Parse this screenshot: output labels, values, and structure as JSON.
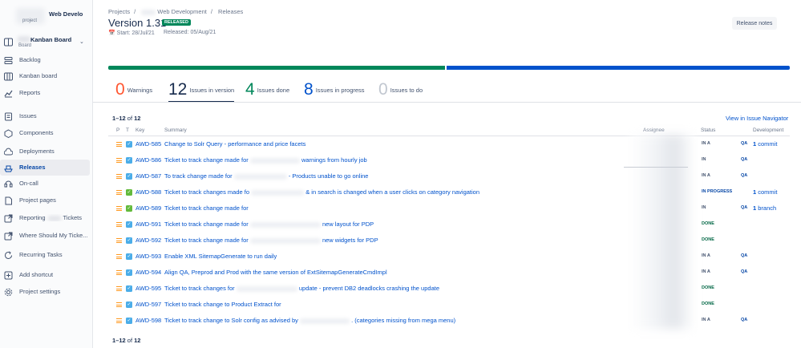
{
  "project": {
    "name": "Web Develo",
    "type": "project"
  },
  "board": {
    "name": "Kanban Board",
    "type": "Board"
  },
  "sidebar": {
    "items": [
      {
        "label": "Backlog",
        "icon": "backlog-icon",
        "name": "sidebar-item-backlog"
      },
      {
        "label": "Kanban board",
        "icon": "board-icon",
        "name": "sidebar-item-kanban-board"
      },
      {
        "label": "Reports",
        "icon": "chart-icon",
        "name": "sidebar-item-reports"
      },
      {
        "label": "Issues",
        "icon": "issues-icon",
        "name": "sidebar-item-issues"
      },
      {
        "label": "Components",
        "icon": "components-icon",
        "name": "sidebar-item-components"
      },
      {
        "label": "Deployments",
        "icon": "cloud-icon",
        "name": "sidebar-item-deployments"
      },
      {
        "label": "Releases",
        "icon": "ship-icon",
        "name": "sidebar-item-releases",
        "active": true
      },
      {
        "label": "On-call",
        "icon": "on-call-icon",
        "name": "sidebar-item-on-call"
      },
      {
        "label": "Project pages",
        "icon": "page-icon",
        "name": "sidebar-item-project-pages"
      },
      {
        "label_a": "Reporting",
        "label_b": "Tickets",
        "icon": "shortcut-icon",
        "name": "sidebar-item-reporting-tickets"
      },
      {
        "label": "Where Should My Ticke...",
        "icon": "shortcut-icon",
        "name": "sidebar-item-where-should"
      },
      {
        "label": "Recurring Tasks",
        "icon": "recurring-icon",
        "name": "sidebar-item-recurring-tasks"
      },
      {
        "label": "Add shortcut",
        "icon": "add-shortcut-icon",
        "name": "sidebar-item-add-shortcut"
      },
      {
        "label": "Project settings",
        "icon": "gear-icon",
        "name": "sidebar-item-project-settings"
      }
    ]
  },
  "breadcrumbs": {
    "projects": "Projects",
    "sep": "/",
    "project": "Web Development",
    "releases": "Releases"
  },
  "version": {
    "title": "Version 1.31",
    "badge": "RELEASED",
    "start": "Start: 28/Jul/21",
    "released": "Released: 05/Aug/21",
    "release_notes_label": "Release notes"
  },
  "progress": {
    "done_fraction": 0.495,
    "in_progress_fraction": 0.505
  },
  "stats": [
    {
      "num": "0",
      "label": "Warnings",
      "color": "#ff5630"
    },
    {
      "num": "12",
      "label": "Issues in version",
      "color": "#172b4d",
      "selected": true
    },
    {
      "num": "4",
      "label": "Issues done",
      "color": "#00875a"
    },
    {
      "num": "8",
      "label": "Issues in progress",
      "color": "#0052cc"
    },
    {
      "num": "0",
      "label": "Issues to do",
      "color": "#c1c7d0"
    }
  ],
  "count": {
    "range": "1–12",
    "of": "of",
    "total": "12"
  },
  "view_navigator": "View in Issue Navigator",
  "columns": {
    "p": "P",
    "t": "T",
    "key": "Key",
    "summary": "Summary",
    "assignee": "Assignee",
    "status": "Status",
    "development": "Development"
  },
  "issues": [
    {
      "key": "AWD-585",
      "type": "task",
      "summary_a": "Change to Solr Query - performance and price facets",
      "blur": 0,
      "summary_b": "",
      "status": "IN A",
      "status_kind": "review",
      "qa": "QA",
      "dev_num": "1",
      "dev_label": "commit"
    },
    {
      "key": "AWD-586",
      "type": "task",
      "summary_a": "Ticket to track change made for",
      "blur": 62,
      "summary_b": "warnings from hourly job",
      "status": "IN",
      "status_kind": "review",
      "qa": "QA",
      "dev_num": "",
      "dev_label": ""
    },
    {
      "key": "AWD-587",
      "type": "task",
      "summary_a": "To track change made for",
      "blur": 66,
      "summary_b": "- Products unable to go online",
      "status": "IN A",
      "status_kind": "review",
      "qa": "QA",
      "dev_num": "",
      "dev_label": ""
    },
    {
      "key": "AWD-588",
      "type": "story",
      "summary_a": "Ticket to track changes made fo",
      "blur": 66,
      "summary_b": "& in search is changed when a user clicks on category navigation",
      "status": "IN PROGRESS",
      "status_kind": "inprog",
      "qa": "",
      "dev_num": "1",
      "dev_label": "commit"
    },
    {
      "key": "AWD-589",
      "type": "story",
      "summary_a": "Ticket to track change made for",
      "blur": 0,
      "summary_b": "",
      "status": "IN",
      "status_kind": "review",
      "qa": "QA",
      "dev_num": "1",
      "dev_label": "branch"
    },
    {
      "key": "AWD-591",
      "type": "task",
      "summary_a": "Ticket to track change made for",
      "blur": 88,
      "summary_b": "new layout for PDP",
      "status": "DONE",
      "status_kind": "done",
      "qa": "",
      "dev_num": "",
      "dev_label": ""
    },
    {
      "key": "AWD-592",
      "type": "task",
      "summary_a": "Ticket to track change made for",
      "blur": 88,
      "summary_b": "new widgets for PDP",
      "status": "DONE",
      "status_kind": "done",
      "qa": "",
      "dev_num": "",
      "dev_label": ""
    },
    {
      "key": "AWD-593",
      "type": "task",
      "summary_a": "Enable XML SitemapGenerate to run daily",
      "blur": 0,
      "summary_b": "",
      "status": "IN A",
      "status_kind": "review",
      "qa": "QA",
      "dev_num": "",
      "dev_label": ""
    },
    {
      "key": "AWD-594",
      "type": "task",
      "summary_a": "Align QA, Preprod and Prod with the same version of ExtSitemapGenerateCmdImpl",
      "blur": 0,
      "summary_b": "",
      "status": "IN A",
      "status_kind": "review",
      "qa": "QA",
      "dev_num": "",
      "dev_label": ""
    },
    {
      "key": "AWD-595",
      "type": "task",
      "summary_a": "Ticket to track changes for",
      "blur": 76,
      "summary_b": "update - prevent DB2 deadlocks crashing the update",
      "status": "DONE",
      "status_kind": "done",
      "qa": "",
      "dev_num": "",
      "dev_label": ""
    },
    {
      "key": "AWD-597",
      "type": "task",
      "summary_a": "Ticket to track change to Product Extract for",
      "blur": 0,
      "summary_b": "",
      "status": "DONE",
      "status_kind": "done",
      "qa": "",
      "dev_num": "",
      "dev_label": ""
    },
    {
      "key": "AWD-598",
      "type": "task",
      "summary_a": "Ticket to track change to Solr config as advised by",
      "blur": 62,
      "summary_b": ". (categories missing from mega menu)",
      "status": "IN A",
      "status_kind": "review",
      "qa": "QA",
      "dev_num": "",
      "dev_label": ""
    }
  ],
  "footer_count": {
    "range": "1–12",
    "of": "of",
    "total": "12"
  }
}
